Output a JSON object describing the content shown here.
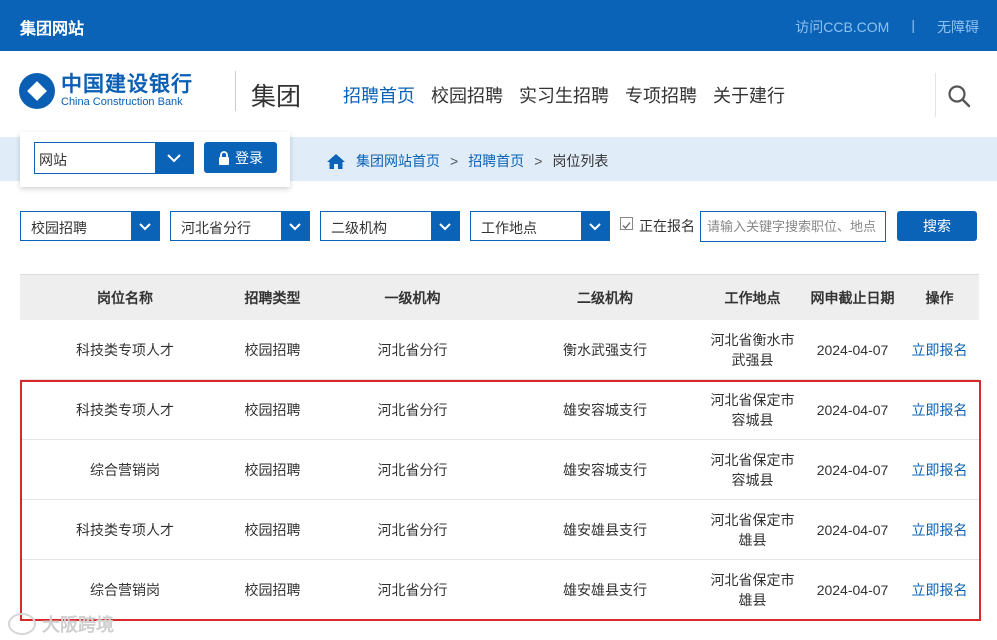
{
  "topbar": {
    "brand": "集团网站",
    "visit_link": "访问CCB.COM",
    "sep": "|",
    "accessibility_link": "无障碍"
  },
  "header": {
    "logo_cn": "中国建设银行",
    "logo_en": "China Construction Bank",
    "group_label": "集团",
    "nav": [
      "招聘首页",
      "校园招聘",
      "实习生招聘",
      "专项招聘",
      "关于建行"
    ],
    "nav_active": 0
  },
  "login": {
    "site_value": "网站",
    "login_label": "登录"
  },
  "breadcrumb": {
    "home": "集团网站首页",
    "level2": "招聘首页",
    "current": "岗位列表",
    "sep": ">"
  },
  "filters": {
    "recruit_type": "校园招聘",
    "branch": "河北省分行",
    "sub_org": "二级机构",
    "location": "工作地点",
    "open_only_label": "正在报名",
    "open_only_checked": true,
    "keyword_placeholder": "请输入关键字搜索职位、地点",
    "search_label": "搜索"
  },
  "table": {
    "headers": [
      "岗位名称",
      "招聘类型",
      "一级机构",
      "二级机构",
      "工作地点",
      "网申截止日期",
      "操作"
    ],
    "rows": [
      {
        "name": "科技类专项人才",
        "type": "校园招聘",
        "org1": "河北省分行",
        "org2": "衡水武强支行",
        "loc1": "河北省衡水市",
        "loc2": "武强县",
        "deadline": "2024-04-07",
        "action": "立即报名"
      },
      {
        "name": "科技类专项人才",
        "type": "校园招聘",
        "org1": "河北省分行",
        "org2": "雄安容城支行",
        "loc1": "河北省保定市",
        "loc2": "容城县",
        "deadline": "2024-04-07",
        "action": "立即报名"
      },
      {
        "name": "综合营销岗",
        "type": "校园招聘",
        "org1": "河北省分行",
        "org2": "雄安容城支行",
        "loc1": "河北省保定市",
        "loc2": "容城县",
        "deadline": "2024-04-07",
        "action": "立即报名"
      },
      {
        "name": "科技类专项人才",
        "type": "校园招聘",
        "org1": "河北省分行",
        "org2": "雄安雄县支行",
        "loc1": "河北省保定市",
        "loc2": "雄县",
        "deadline": "2024-04-07",
        "action": "立即报名"
      },
      {
        "name": "综合营销岗",
        "type": "校园招聘",
        "org1": "河北省分行",
        "org2": "雄安雄县支行",
        "loc1": "河北省保定市",
        "loc2": "雄县",
        "deadline": "2024-04-07",
        "action": "立即报名"
      }
    ]
  },
  "watermark": "大阪跨境",
  "colors": {
    "primary": "#0a63b7",
    "highlight_border": "#d9272c",
    "crumb_band": "#e0edf8"
  }
}
